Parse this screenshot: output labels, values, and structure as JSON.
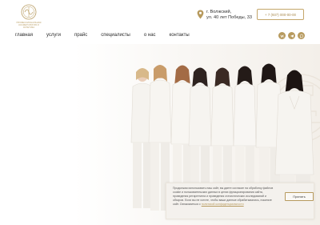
{
  "brand": {
    "tagline": "ПРОФЕССИОНАЛЬНАЯ КОСМЕТОЛОГИЯ И ЭСТЕТИКА",
    "accent_color": "#b79a5e"
  },
  "contact": {
    "address_line1": "г. Волжский,",
    "address_line2": "ул. 40 лет Победы, 33",
    "phone": "+ 7 (937) 000-00-00"
  },
  "nav": {
    "items": [
      {
        "label": "главная"
      },
      {
        "label": "услуги"
      },
      {
        "label": "прайс"
      },
      {
        "label": "специалисты"
      },
      {
        "label": "о нас"
      },
      {
        "label": "контакты"
      }
    ]
  },
  "social": [
    "vk-icon",
    "telegram-icon",
    "whatsapp-icon"
  ],
  "cookie": {
    "text": "Продолжая использовать наш сайт, вы даете согласие на обработку файлов cookie и пользовательских данных в целях функционирования сайта, проведения ретаргетинга и проведения статистических исследований и обзоров. Если вы не хотите, чтобы ваши данные обрабатывались, покиньте сайт. Ознакомиться с",
    "link_label": "политикой конфиденциальности",
    "accept_label": "Принять"
  }
}
